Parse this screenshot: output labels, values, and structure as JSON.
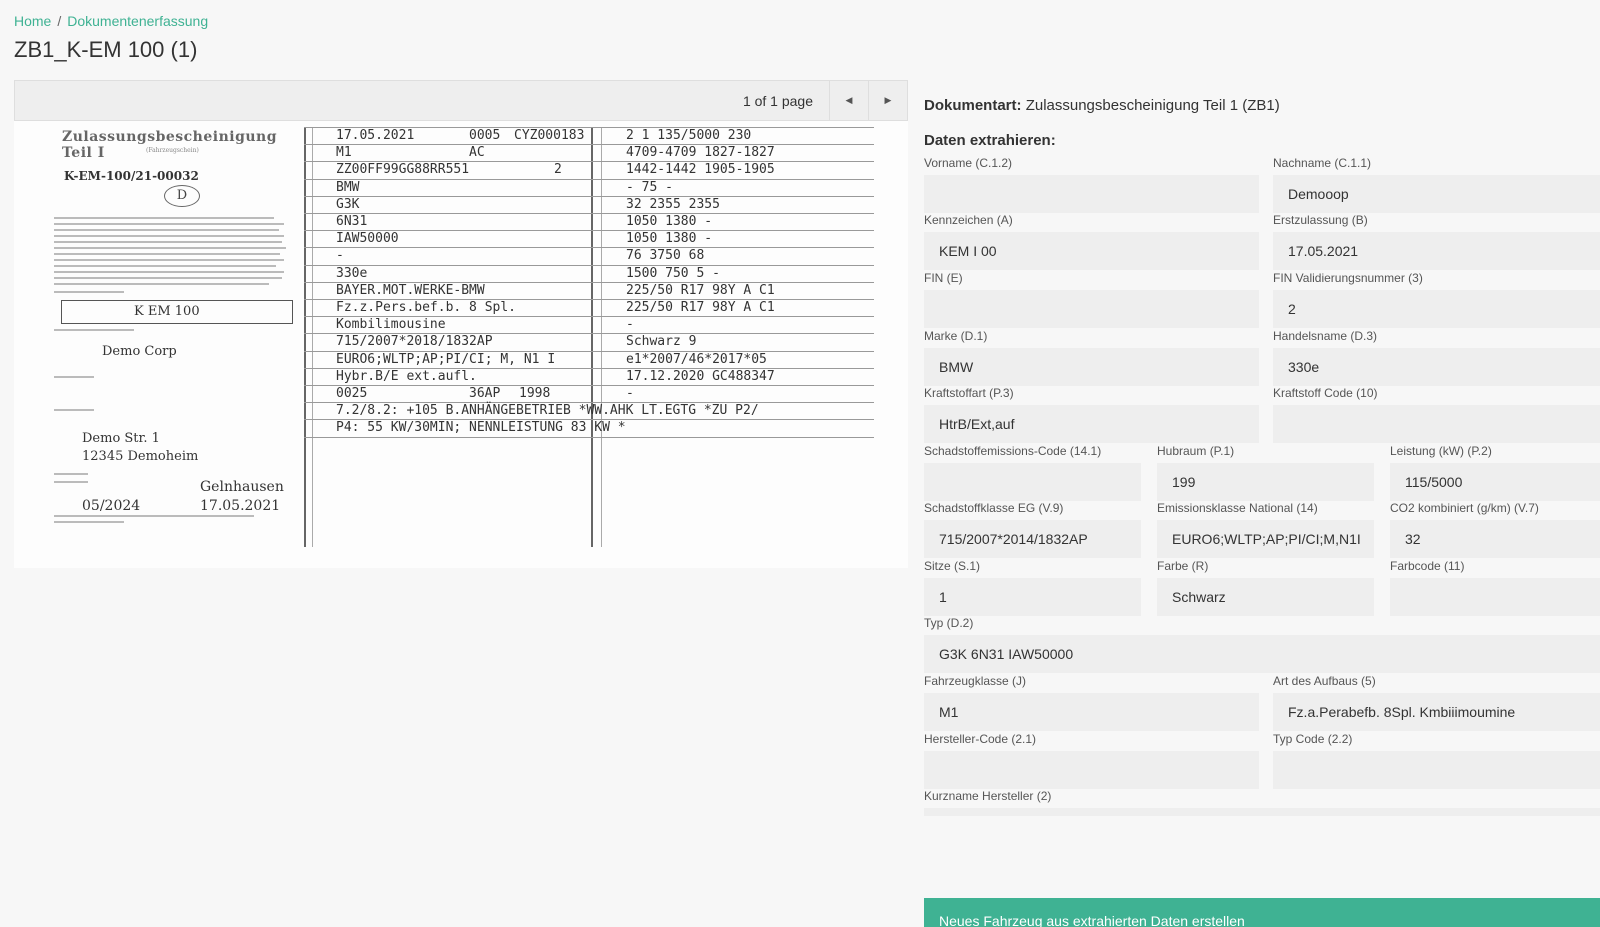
{
  "breadcrumb": {
    "home": "Home",
    "separator": "/",
    "current": "Dokumentenerfassung"
  },
  "page_title": "ZB1_K-EM 100 (1)",
  "viewer": {
    "page_info": "1 of 1 page",
    "prev_icon": "caret-left-icon",
    "next_icon": "caret-right-icon",
    "prev_glyph": "◀",
    "next_glyph": "▶",
    "document": {
      "heading": "Zulassungsbescheinigung Teil I",
      "subheading": "(Fahrzeugschein)",
      "registration_no": "K-EM-100/21-00032",
      "country_code": "D",
      "plate": "K EM 100",
      "holder": "Demo Corp",
      "street": "Demo Str. 1",
      "city": "12345 Demoheim",
      "town": "Gelnhausen",
      "valid_until": "05/2024",
      "issue_date": "17.05.2021",
      "rows_left": [
        "17.05.2021",
        "M1",
        "ZZ00FF99GG88RR551",
        "BMW",
        "G3K",
        "6N31",
        "IAW50000",
        "-",
        "330e",
        "BAYER.MOT.WERKE-BMW",
        "Fz.z.Pers.bef.b. 8 Spl.",
        "Kombilimousine",
        "715/2007*2018/1832AP",
        "EURO6;WLTP;AP;PI/CI; M, N1 I",
        "Hybr.B/E ext.aufl.",
        "0025"
      ],
      "rows_mid": [
        "0005",
        "AC",
        "2",
        "",
        "",
        "",
        "",
        "",
        "",
        "",
        "",
        "",
        "",
        "",
        "",
        "36AP"
      ],
      "row1_extra": "CYZ000183",
      "row16_extra": "1998",
      "rows_right": [
        "2   1   135/5000   230",
        "4709-4709   1827-1827",
        "1442-1442   1905-1905",
        "-   75   -",
        "32   2355   2355",
        "1050   1380   -",
        "1050   1380   -",
        "76   3750   68",
        "1500   750   5   -",
        "225/50 R17 98Y A C1",
        "225/50 R17 98Y A C1",
        "-",
        "Schwarz   9",
        "e1*2007/46*2017*05",
        "17.12.2020   GC488347",
        "-"
      ],
      "remarks_1": "7.2/8.2: +105 B.ANHÄNGEBETRIEB *WW.AHK LT.EGTG *ZU P2/",
      "remarks_2": "P4: 55 KW/30MIN; NENNLEISTUNG 83 KW *"
    }
  },
  "doc_type": {
    "label": "Dokumentart:",
    "value": "Zulassungsbescheinigung Teil 1 (ZB1)"
  },
  "extract_heading": "Daten extrahieren:",
  "fields": {
    "vorname": {
      "label": "Vorname (C.1.2)",
      "value": ""
    },
    "nachname": {
      "label": "Nachname (C.1.1)",
      "value": "Demooop"
    },
    "kennzeichen": {
      "label": "Kennzeichen (A)",
      "value": "KEM I 00"
    },
    "erstzulassung": {
      "label": "Erstzulassung (B)",
      "value": "17.05.2021"
    },
    "fin": {
      "label": "FIN (E)",
      "value": ""
    },
    "fin_pruef": {
      "label": "FIN Validierungsnummer (3)",
      "value": "2"
    },
    "marke": {
      "label": "Marke (D.1)",
      "value": "BMW"
    },
    "handelsname": {
      "label": "Handelsname (D.3)",
      "value": "330e"
    },
    "kraftstoffart": {
      "label": "Kraftstoffart (P.3)",
      "value": "HtrB/Ext,auf"
    },
    "kraftstoff_code": {
      "label": "Kraftstoff Code (10)",
      "value": ""
    },
    "schadstoff_code": {
      "label": "Schadstoffemissions-Code (14.1)",
      "value": ""
    },
    "hubraum": {
      "label": "Hubraum (P.1)",
      "value": "199"
    },
    "leistung": {
      "label": "Leistung (kW) (P.2)",
      "value": "115/5000"
    },
    "schadstoffklasse": {
      "label": "Schadstoffklasse EG (V.9)",
      "value": "715/2007*2014/1832AP"
    },
    "emissionsklasse": {
      "label": "Emissionsklasse National (14)",
      "value": "EURO6;WLTP;AP;PI/CI;M,N1I"
    },
    "co2": {
      "label": "CO2 kombiniert (g/km) (V.7)",
      "value": "32"
    },
    "sitze": {
      "label": "Sitze (S.1)",
      "value": "1"
    },
    "farbe": {
      "label": "Farbe (R)",
      "value": "Schwarz"
    },
    "farbcode": {
      "label": "Farbcode (11)",
      "value": ""
    },
    "typ": {
      "label": "Typ (D.2)",
      "value": "G3K 6N31 IAW50000"
    },
    "fahrzeugklasse": {
      "label": "Fahrzeugklasse (J)",
      "value": "M1"
    },
    "aufbau": {
      "label": "Art des Aufbaus (5)",
      "value": "Fz.a.Perabefb. 8Spl. Kmbiiimoumine"
    },
    "hersteller_code": {
      "label": "Hersteller-Code (2.1)",
      "value": ""
    },
    "typ_code": {
      "label": "Typ Code (2.2)",
      "value": ""
    },
    "kurzname": {
      "label": "Kurzname Hersteller (2)",
      "value": ""
    }
  },
  "submit_label": "Neues Fahrzeug aus extrahierten Daten erstellen",
  "colors": {
    "accent": "#3fb293",
    "input_bg": "#eeeeee",
    "page_bg": "#f7f7f7"
  }
}
